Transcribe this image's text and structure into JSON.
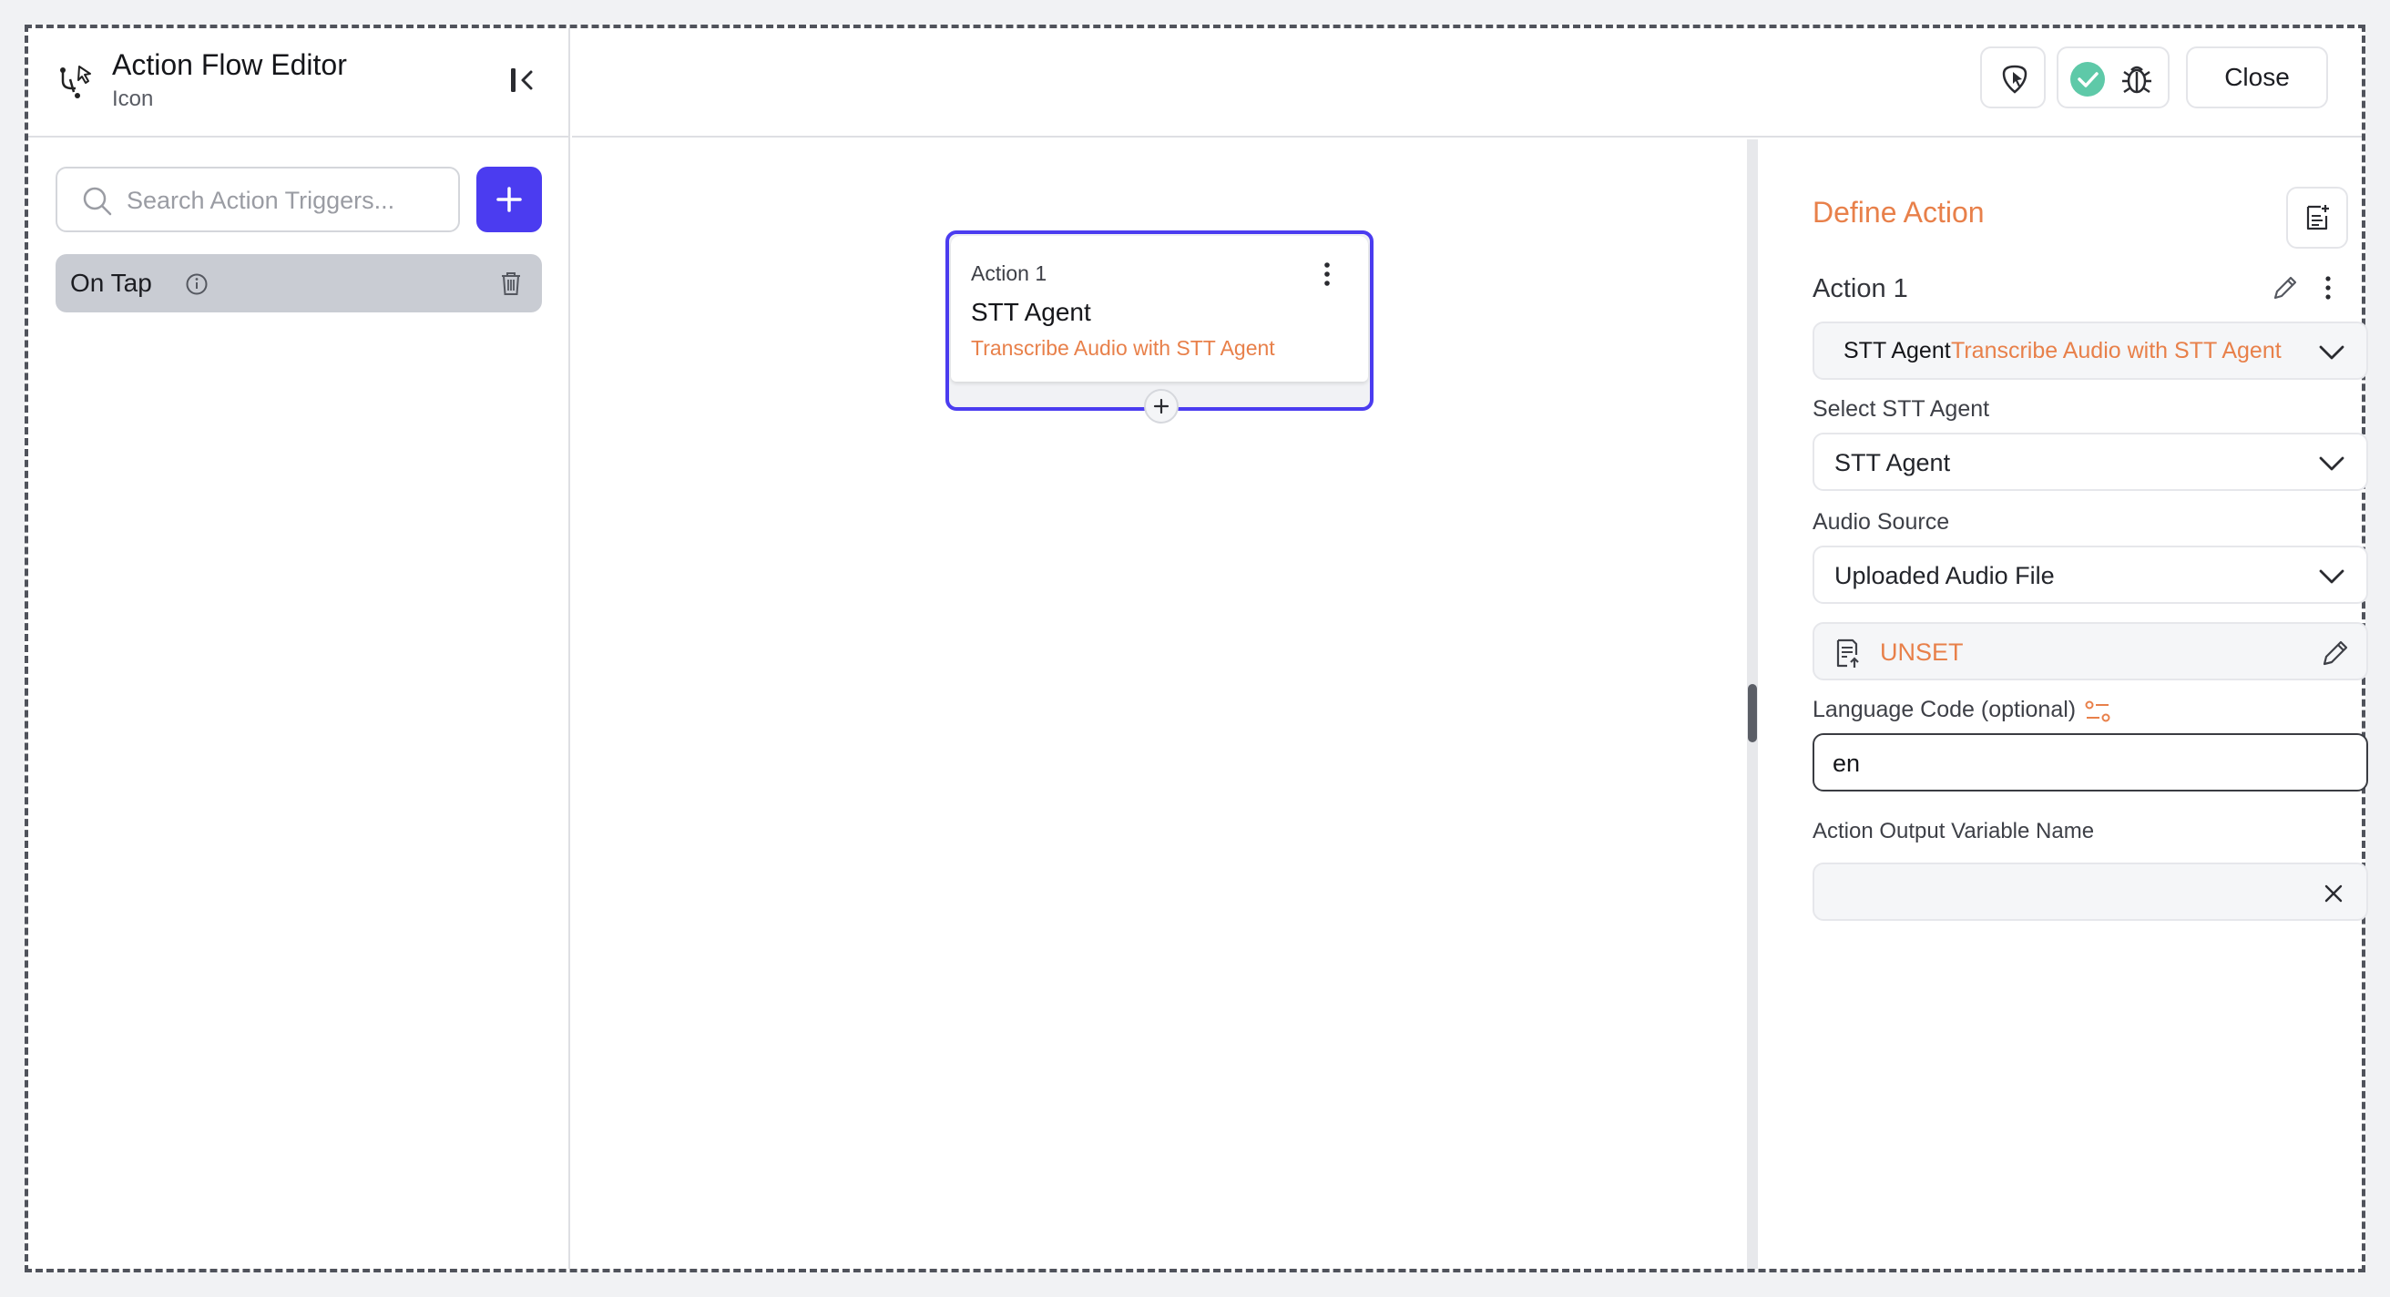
{
  "header": {
    "title": "Action Flow Editor",
    "subtitle": "Icon",
    "close_label": "Close"
  },
  "sidebar": {
    "search_placeholder": "Search Action Triggers...",
    "triggers": [
      {
        "label": "On Tap"
      }
    ]
  },
  "canvas": {
    "node": {
      "step": "Action 1",
      "title": "STT Agent",
      "subtitle": "Transcribe Audio with STT Agent"
    }
  },
  "panel": {
    "title": "Define Action",
    "action_name": "Action 1",
    "action_type": {
      "name": "STT Agent",
      "description": "Transcribe Audio with STT Agent"
    },
    "select_agent": {
      "label": "Select STT Agent",
      "value": "STT Agent"
    },
    "audio_source": {
      "label": "Audio Source",
      "value": "Uploaded Audio File"
    },
    "audio_file": {
      "value": "UNSET"
    },
    "language_code": {
      "label": "Language Code (optional)",
      "value": "en"
    },
    "output_variable": {
      "label": "Action Output Variable Name",
      "value": ""
    }
  },
  "colors": {
    "primary": "#4b3cf0",
    "accent_orange": "#e8804a",
    "success": "#5ec9a8"
  }
}
